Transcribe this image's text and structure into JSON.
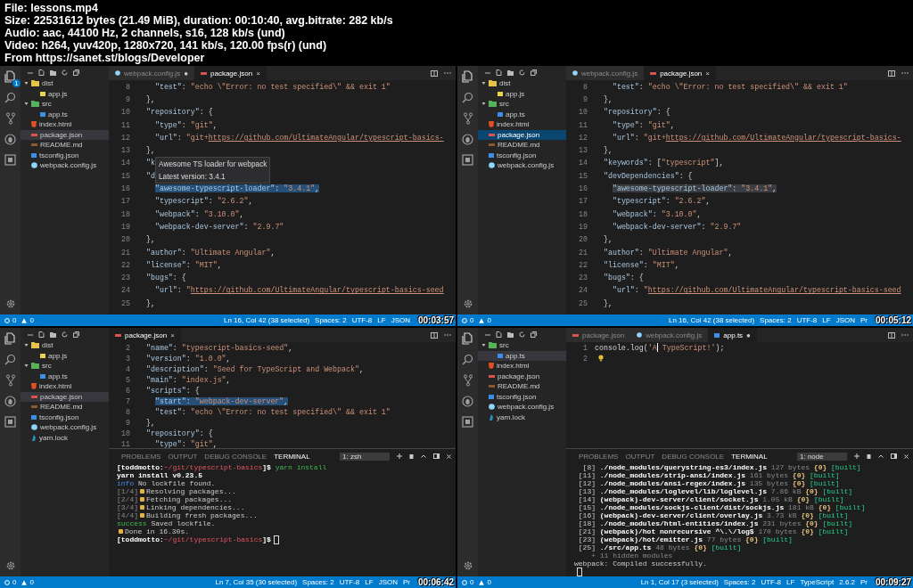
{
  "header": [
    "File: lessons.mp4",
    "Size: 22531612 bytes (21.49 MiB), duration: 00:10:40, avg.bitrate: 282 kb/s",
    "Audio: aac, 44100 Hz, 2 channels, s16, 128 kb/s (und)",
    "Video: h264, yuv420p, 1280x720, 141 kb/s, 120.00 fps(r) (und)",
    "From https://sanet.st/blogs/Developer"
  ],
  "panes": [
    {
      "activity_badge": "1",
      "explorer_focused": false,
      "editor_focused": true,
      "explorer": [
        {
          "name": "dist",
          "kind": "folder",
          "color": "#e8c34a",
          "expanded": true,
          "selected": false,
          "children": [
            {
              "name": "app.js",
              "kind": "js",
              "selected": false
            }
          ]
        },
        {
          "name": "src",
          "kind": "folder",
          "color": "#56b35a",
          "expanded": true,
          "selected": false,
          "children": [
            {
              "name": "app.ts",
              "kind": "ts",
              "selected": false
            }
          ]
        },
        {
          "name": "index.html",
          "kind": "html",
          "selected": false
        },
        {
          "name": "package.json",
          "kind": "json",
          "selected": true
        },
        {
          "name": "README.md",
          "kind": "md",
          "selected": false
        },
        {
          "name": "tsconfig.json",
          "kind": "tsconfig",
          "selected": false
        },
        {
          "name": "webpack.config.js",
          "kind": "webpack",
          "selected": false
        }
      ],
      "tabs": [
        {
          "label": "webpack.config.js",
          "kind": "webpack",
          "selected": false,
          "marker": "●"
        },
        {
          "label": "package.json",
          "kind": "json",
          "selected": true,
          "marker": "×"
        }
      ],
      "lines": [
        {
          "num": "8",
          "tokens": [
            {
              "kind": "key",
              "text": "    \"test\""
            },
            {
              "kind": "punct",
              "text": ": "
            },
            {
              "kind": "str",
              "text": "\"echo \\\"Error: no test specified\\\" && exit 1\""
            }
          ]
        },
        {
          "num": "9",
          "tokens": [
            {
              "kind": "punct",
              "text": "  },"
            }
          ]
        },
        {
          "num": "10",
          "tokens": [
            {
              "kind": "key",
              "text": "  \"repository\""
            },
            {
              "kind": "punct",
              "text": ": {"
            }
          ]
        },
        {
          "num": "11",
          "tokens": [
            {
              "kind": "key",
              "text": "    \"type\""
            },
            {
              "kind": "punct",
              "text": ": "
            },
            {
              "kind": "str",
              "text": "\"git\""
            },
            {
              "kind": "punct",
              "text": ","
            }
          ]
        },
        {
          "num": "12",
          "tokens": [
            {
              "kind": "key",
              "text": "    \"url\""
            },
            {
              "kind": "punct",
              "text": ": "
            },
            {
              "kind": "str",
              "text": "\"git+"
            },
            {
              "kind": "link",
              "text": "https://github.com/UltimateAngular/typescript-basics-"
            }
          ]
        },
        {
          "num": "13",
          "tokens": [
            {
              "kind": "punct",
              "text": "  },"
            }
          ]
        },
        {
          "num": "14",
          "tokens": [
            {
              "kind": "key",
              "text": "  \"k"
            }
          ],
          "tooltip": [
            "Awesome TS loader for webpack",
            "Latest version: 3.4.1"
          ]
        },
        {
          "num": "15",
          "tokens": [
            {
              "kind": "key",
              "text": "  \"d"
            }
          ]
        },
        {
          "num": "16",
          "selected": true,
          "tokens": [
            {
              "kind": "key",
              "text": "    \"awesome-typescript-loader\""
            },
            {
              "kind": "punct",
              "text": ": "
            },
            {
              "kind": "str",
              "text": "\"3.4.1\""
            },
            {
              "kind": "punct",
              "text": ","
            }
          ]
        },
        {
          "num": "17",
          "tokens": [
            {
              "kind": "key",
              "text": "    \"typescript\""
            },
            {
              "kind": "punct",
              "text": ": "
            },
            {
              "kind": "str",
              "text": "\"2.6.2\""
            },
            {
              "kind": "punct",
              "text": ","
            }
          ]
        },
        {
          "num": "18",
          "tokens": [
            {
              "kind": "key",
              "text": "    \"webpack\""
            },
            {
              "kind": "punct",
              "text": ": "
            },
            {
              "kind": "str",
              "text": "\"3.10.0\""
            },
            {
              "kind": "punct",
              "text": ","
            }
          ]
        },
        {
          "num": "19",
          "tokens": [
            {
              "kind": "key",
              "text": "    \"webpack-dev-server\""
            },
            {
              "kind": "punct",
              "text": ": "
            },
            {
              "kind": "str",
              "text": "\"2.9.7\""
            }
          ]
        },
        {
          "num": "20",
          "tokens": [
            {
              "kind": "punct",
              "text": "  },"
            }
          ]
        },
        {
          "num": "21",
          "tokens": [
            {
              "kind": "key",
              "text": "  \"author\""
            },
            {
              "kind": "punct",
              "text": ": "
            },
            {
              "kind": "str",
              "text": "\"Ultimate Angular\""
            },
            {
              "kind": "punct",
              "text": ","
            }
          ]
        },
        {
          "num": "22",
          "tokens": [
            {
              "kind": "key",
              "text": "  \"license\""
            },
            {
              "kind": "punct",
              "text": ": "
            },
            {
              "kind": "str",
              "text": "\"MIT\""
            },
            {
              "kind": "punct",
              "text": ","
            }
          ]
        },
        {
          "num": "23",
          "tokens": [
            {
              "kind": "key",
              "text": "  \"bugs\""
            },
            {
              "kind": "punct",
              "text": ": {"
            }
          ]
        },
        {
          "num": "24",
          "tokens": [
            {
              "kind": "key",
              "text": "    \"url\""
            },
            {
              "kind": "punct",
              "text": ": "
            },
            {
              "kind": "str",
              "text": "\""
            },
            {
              "kind": "link",
              "text": "https://github.com/UltimateAngular/typescript-basics-seed"
            }
          ]
        },
        {
          "num": "25",
          "tokens": [
            {
              "kind": "punct",
              "text": "  },"
            }
          ]
        }
      ],
      "status": {
        "errors": "0",
        "warnings": "0",
        "items": [
          "Ln 16, Col 42 (38 selected)",
          "Spaces: 2",
          "UTF-8",
          "LF",
          "JSON"
        ],
        "timestamp": "00:03:57"
      }
    },
    {
      "explorer_focused": true,
      "editor_focused": false,
      "explorer": [
        {
          "name": "dist",
          "kind": "folder",
          "color": "#e8c34a",
          "expanded": true,
          "selected": false,
          "children": [
            {
              "name": "app.js",
              "kind": "js",
              "selected": false
            }
          ]
        },
        {
          "name": "src",
          "kind": "folder",
          "color": "#56b35a",
          "expanded": true,
          "selected": false,
          "children": [
            {
              "name": "app.ts",
              "kind": "ts",
              "selected": false
            }
          ]
        },
        {
          "name": "index.html",
          "kind": "html",
          "selected": false
        },
        {
          "name": "package.json",
          "kind": "json",
          "selected": true
        },
        {
          "name": "README.md",
          "kind": "md",
          "selected": false
        },
        {
          "name": "tsconfig.json",
          "kind": "tsconfig",
          "selected": false
        },
        {
          "name": "webpack.config.js",
          "kind": "webpack",
          "selected": false
        }
      ],
      "tabs": [
        {
          "label": "webpack.config.js",
          "kind": "webpack",
          "selected": false
        },
        {
          "label": "package.json",
          "kind": "json",
          "selected": true,
          "marker": "×"
        }
      ],
      "lines": [
        {
          "num": "8",
          "tokens": [
            {
              "kind": "key",
              "text": "    \"test\""
            },
            {
              "kind": "punct",
              "text": ": "
            },
            {
              "kind": "str",
              "text": "\"echo \\\"Error: no test specified\\\" && exit 1\""
            }
          ]
        },
        {
          "num": "9",
          "tokens": [
            {
              "kind": "punct",
              "text": "  },"
            }
          ]
        },
        {
          "num": "10",
          "tokens": [
            {
              "kind": "key",
              "text": "  \"repository\""
            },
            {
              "kind": "punct",
              "text": ": {"
            }
          ]
        },
        {
          "num": "11",
          "tokens": [
            {
              "kind": "key",
              "text": "    \"type\""
            },
            {
              "kind": "punct",
              "text": ": "
            },
            {
              "kind": "str",
              "text": "\"git\""
            },
            {
              "kind": "punct",
              "text": ","
            }
          ]
        },
        {
          "num": "12",
          "tokens": [
            {
              "kind": "key",
              "text": "    \"url\""
            },
            {
              "kind": "punct",
              "text": ": "
            },
            {
              "kind": "str",
              "text": "\"git+"
            },
            {
              "kind": "link",
              "text": "https://github.com/UltimateAngular/typescript-basics-"
            }
          ]
        },
        {
          "num": "13",
          "tokens": [
            {
              "kind": "punct",
              "text": "  },"
            }
          ]
        },
        {
          "num": "14",
          "tokens": [
            {
              "kind": "key",
              "text": "  \"keywords\""
            },
            {
              "kind": "punct",
              "text": ": ["
            },
            {
              "kind": "str",
              "text": "\"typescript\""
            },
            {
              "kind": "punct",
              "text": "],"
            }
          ]
        },
        {
          "num": "15",
          "tokens": [
            {
              "kind": "key",
              "text": "  \"devDependencies\""
            },
            {
              "kind": "punct",
              "text": ": {"
            }
          ]
        },
        {
          "num": "16",
          "selected": true,
          "tokens": [
            {
              "kind": "key",
              "text": "    \"awesome-typescript-loader\""
            },
            {
              "kind": "punct",
              "text": ": "
            },
            {
              "kind": "str",
              "text": "\"3.4.1\""
            },
            {
              "kind": "punct",
              "text": ","
            }
          ]
        },
        {
          "num": "17",
          "tokens": [
            {
              "kind": "key",
              "text": "    \"typescript\""
            },
            {
              "kind": "punct",
              "text": ": "
            },
            {
              "kind": "str",
              "text": "\"2.6.2\""
            },
            {
              "kind": "punct",
              "text": ","
            }
          ]
        },
        {
          "num": "18",
          "tokens": [
            {
              "kind": "key",
              "text": "    \"webpack\""
            },
            {
              "kind": "punct",
              "text": ": "
            },
            {
              "kind": "str",
              "text": "\"3.10.0\""
            },
            {
              "kind": "punct",
              "text": ","
            }
          ]
        },
        {
          "num": "19",
          "tokens": [
            {
              "kind": "key",
              "text": "    \"webpack-dev-server\""
            },
            {
              "kind": "punct",
              "text": ": "
            },
            {
              "kind": "str",
              "text": "\"2.9.7\""
            }
          ]
        },
        {
          "num": "20",
          "tokens": [
            {
              "kind": "punct",
              "text": "  },"
            }
          ]
        },
        {
          "num": "21",
          "tokens": [
            {
              "kind": "key",
              "text": "  \"author\""
            },
            {
              "kind": "punct",
              "text": ": "
            },
            {
              "kind": "str",
              "text": "\"Ultimate Angular\""
            },
            {
              "kind": "punct",
              "text": ","
            }
          ]
        },
        {
          "num": "22",
          "tokens": [
            {
              "kind": "key",
              "text": "  \"license\""
            },
            {
              "kind": "punct",
              "text": ": "
            },
            {
              "kind": "str",
              "text": "\"MIT\""
            },
            {
              "kind": "punct",
              "text": ","
            }
          ]
        },
        {
          "num": "23",
          "tokens": [
            {
              "kind": "key",
              "text": "  \"bugs\""
            },
            {
              "kind": "punct",
              "text": ": {"
            }
          ]
        },
        {
          "num": "24",
          "tokens": [
            {
              "kind": "key",
              "text": "    \"url\""
            },
            {
              "kind": "punct",
              "text": ": "
            },
            {
              "kind": "str",
              "text": "\""
            },
            {
              "kind": "link",
              "text": "https://github.com/UltimateAngular/typescript-basics-seed"
            }
          ]
        },
        {
          "num": "25",
          "tokens": [
            {
              "kind": "punct",
              "text": "  },"
            }
          ]
        }
      ],
      "status": {
        "errors": "0",
        "warnings": "0",
        "items": [
          "Ln 16, Col 42 (38 selected)",
          "Spaces: 2",
          "UTF-8",
          "LF",
          "JSON",
          "Pr"
        ],
        "timestamp": "00:05:12"
      }
    },
    {
      "explorer_focused": false,
      "editor_focused": true,
      "explorer": [
        {
          "name": "dist",
          "kind": "folder",
          "color": "#e8c34a",
          "expanded": true,
          "selected": false,
          "children": [
            {
              "name": "app.js",
              "kind": "js",
              "selected": false
            }
          ]
        },
        {
          "name": "src",
          "kind": "folder",
          "color": "#56b35a",
          "expanded": true,
          "selected": false,
          "children": [
            {
              "name": "app.ts",
              "kind": "ts",
              "selected": false
            }
          ]
        },
        {
          "name": "index.html",
          "kind": "html",
          "selected": false
        },
        {
          "name": "package.json",
          "kind": "json",
          "selected": true
        },
        {
          "name": "README.md",
          "kind": "md",
          "selected": false
        },
        {
          "name": "tsconfig.json",
          "kind": "tsconfig",
          "selected": false
        },
        {
          "name": "webpack.config.js",
          "kind": "webpack",
          "selected": false
        },
        {
          "name": "yarn.lock",
          "kind": "yarn",
          "selected": false
        }
      ],
      "tabs": [
        {
          "label": "package.json",
          "kind": "json",
          "selected": true,
          "marker": "×"
        }
      ],
      "lines": [
        {
          "num": "2",
          "tokens": [
            {
              "kind": "key",
              "text": "  \"name\""
            },
            {
              "kind": "punct",
              "text": ": "
            },
            {
              "kind": "str",
              "text": "\"typescript-basics-seed\""
            },
            {
              "kind": "punct",
              "text": ","
            }
          ]
        },
        {
          "num": "3",
          "tokens": [
            {
              "kind": "key",
              "text": "  \"version\""
            },
            {
              "kind": "punct",
              "text": ": "
            },
            {
              "kind": "str",
              "text": "\"1.0.0\""
            },
            {
              "kind": "punct",
              "text": ","
            }
          ]
        },
        {
          "num": "4",
          "tokens": [
            {
              "kind": "key",
              "text": "  \"description\""
            },
            {
              "kind": "punct",
              "text": ": "
            },
            {
              "kind": "str",
              "text": "\"Seed for TypeScript and Webpack\""
            },
            {
              "kind": "punct",
              "text": ","
            }
          ]
        },
        {
          "num": "5",
          "tokens": [
            {
              "kind": "key",
              "text": "  \"main\""
            },
            {
              "kind": "punct",
              "text": ": "
            },
            {
              "kind": "str",
              "text": "\"index.js\""
            },
            {
              "kind": "punct",
              "text": ","
            }
          ]
        },
        {
          "num": "6",
          "tokens": [
            {
              "kind": "key",
              "text": "  \"scripts\""
            },
            {
              "kind": "punct",
              "text": ": {"
            }
          ]
        },
        {
          "num": "7",
          "selected": true,
          "tokens": [
            {
              "kind": "key",
              "text": "    \"start\""
            },
            {
              "kind": "punct",
              "text": ": "
            },
            {
              "kind": "str",
              "text": "\"webpack-dev-server\""
            },
            {
              "kind": "punct",
              "text": ","
            }
          ]
        },
        {
          "num": "8",
          "tokens": [
            {
              "kind": "key",
              "text": "    \"test\""
            },
            {
              "kind": "punct",
              "text": ": "
            },
            {
              "kind": "str",
              "text": "\"echo \\\"Error: no test specified\\\" && exit 1\""
            }
          ]
        },
        {
          "num": "9",
          "tokens": [
            {
              "kind": "punct",
              "text": "  },"
            }
          ]
        },
        {
          "num": "10",
          "tokens": [
            {
              "kind": "key",
              "text": "  \"repository\""
            },
            {
              "kind": "punct",
              "text": ": {"
            }
          ]
        },
        {
          "num": "11",
          "tokens": [
            {
              "kind": "key",
              "text": "    \"type\""
            },
            {
              "kind": "punct",
              "text": ": "
            },
            {
              "kind": "str",
              "text": "\"git\""
            },
            {
              "kind": "punct",
              "text": ","
            }
          ]
        }
      ],
      "terminal": {
        "tabs": [
          {
            "label": "PROBLEMS",
            "selected": false
          },
          {
            "label": "OUTPUT",
            "selected": false
          },
          {
            "label": "DEBUG CONSOLE",
            "selected": false
          },
          {
            "label": "TERMINAL",
            "selected": true
          }
        ],
        "shell": "1: zsh",
        "lines": [
          [
            {
              "kind": "bold",
              "text": "[toddmotto:"
            },
            {
              "kind": "path",
              "text": "~/git/typescript-basics"
            },
            {
              "kind": "bold",
              "text": "]$ "
            },
            {
              "kind": "cmd",
              "text": "yarn install"
            }
          ],
          [
            {
              "kind": "bold",
              "text": "yarn install v0.23.5"
            }
          ],
          [
            {
              "kind": "info",
              "text": "info"
            },
            {
              "kind": "plain",
              "text": " No lockfile found."
            }
          ],
          [
            {
              "kind": "dim",
              "text": "[1/4]"
            },
            {
              "kind": "emoji"
            },
            {
              "kind": "plain",
              "text": "Resolving packages..."
            }
          ],
          [
            {
              "kind": "dim",
              "text": "[2/4]"
            },
            {
              "kind": "emoji"
            },
            {
              "kind": "plain",
              "text": "Fetching packages..."
            }
          ],
          [
            {
              "kind": "dim",
              "text": "[3/4]"
            },
            {
              "kind": "emoji"
            },
            {
              "kind": "plain",
              "text": "Linking dependencies..."
            }
          ],
          [
            {
              "kind": "dim",
              "text": "[4/4]"
            },
            {
              "kind": "emoji"
            },
            {
              "kind": "plain",
              "text": "Building fresh packages..."
            }
          ],
          [
            {
              "kind": "success",
              "text": "success"
            },
            {
              "kind": "plain",
              "text": " Saved lockfile."
            }
          ],
          [
            {
              "kind": "emoji"
            },
            {
              "kind": "plain",
              "text": "Done in 16.30s."
            }
          ],
          [
            {
              "kind": "bold",
              "text": "[toddmotto:"
            },
            {
              "kind": "path",
              "text": "~/git/typescript-basics"
            },
            {
              "kind": "bold",
              "text": "]$"
            },
            {
              "kind": "cursor"
            }
          ]
        ]
      },
      "status": {
        "errors": "0",
        "warnings": "0",
        "items": [
          "Ln 7, Col 35 (30 selected)",
          "Spaces: 2",
          "UTF-8",
          "LF",
          "JSON",
          "Pr"
        ],
        "timestamp": "00:06:42"
      }
    },
    {
      "explorer_focused": false,
      "explorer": [
        {
          "name": "src",
          "kind": "folder",
          "color": "#56b35a",
          "expanded": true,
          "selected": false,
          "children": [
            {
              "name": "app.ts",
              "kind": "ts",
              "selected": true
            }
          ]
        },
        {
          "name": "index.html",
          "kind": "html",
          "selected": false
        },
        {
          "name": "package.json",
          "kind": "json",
          "selected": false
        },
        {
          "name": "README.md",
          "kind": "md",
          "selected": false
        },
        {
          "name": "tsconfig.json",
          "kind": "tsconfig",
          "selected": false
        },
        {
          "name": "webpack.config.js",
          "kind": "webpack",
          "selected": false
        },
        {
          "name": "yarn.lock",
          "kind": "yarn",
          "selected": false
        }
      ],
      "tabs": [
        {
          "label": "package.json",
          "kind": "json",
          "selected": false
        },
        {
          "label": "webpack.config.js",
          "kind": "webpack",
          "selected": false
        },
        {
          "label": "app.ts",
          "kind": "ts",
          "selected": true,
          "marker": "●"
        }
      ],
      "lines": [
        {
          "num": "1",
          "tokens": [
            {
              "kind": "plain",
              "text": "console.log("
            },
            {
              "kind": "str",
              "text": "'A"
            },
            {
              "kind": "caret"
            },
            {
              "kind": "str",
              "text": " TypeScript!'"
            },
            {
              "kind": "plain",
              "text": ");"
            }
          ]
        },
        {
          "num": "2",
          "tokens": [
            {
              "kind": "bulb"
            }
          ]
        }
      ],
      "terminal": {
        "tabs": [
          {
            "label": "PROBLEMS",
            "selected": false
          },
          {
            "label": "OUTPUT",
            "selected": false
          },
          {
            "label": "DEBUG CONSOLE",
            "selected": false
          },
          {
            "label": "TERMINAL",
            "selected": true
          }
        ],
        "shell": "1: node",
        "lines": [
          [
            {
              "kind": "plain",
              "text": "  [8] "
            },
            {
              "kind": "bold",
              "text": "./node_modules/querystring-es3/index.js"
            },
            {
              "kind": "dim",
              "text": " 127 bytes "
            },
            {
              "kind": "chunk",
              "text": "{0}"
            },
            {
              "kind": "built",
              "text": " [built]"
            }
          ],
          [
            {
              "kind": "plain",
              "text": " [11] "
            },
            {
              "kind": "bold",
              "text": "./node_modules/strip-ansi/index.js"
            },
            {
              "kind": "dim",
              "text": " 161 bytes "
            },
            {
              "kind": "chunk",
              "text": "{0}"
            },
            {
              "kind": "built",
              "text": " [built]"
            }
          ],
          [
            {
              "kind": "plain",
              "text": " [12] "
            },
            {
              "kind": "bold",
              "text": "./node_modules/ansi-regex/index.js"
            },
            {
              "kind": "dim",
              "text": " 135 bytes "
            },
            {
              "kind": "chunk",
              "text": "{0}"
            },
            {
              "kind": "built",
              "text": " [built]"
            }
          ],
          [
            {
              "kind": "plain",
              "text": " [13] "
            },
            {
              "kind": "bold",
              "text": "./node_modules/loglevel/lib/loglevel.js"
            },
            {
              "kind": "dim",
              "text": " 7.86 kB "
            },
            {
              "kind": "chunk",
              "text": "{0}"
            },
            {
              "kind": "built",
              "text": " [built]"
            }
          ],
          [
            {
              "kind": "plain",
              "text": " [14] "
            },
            {
              "kind": "bold",
              "text": "(webpack)-dev-server/client/socket.js"
            },
            {
              "kind": "dim",
              "text": " 1.05 kB "
            },
            {
              "kind": "chunk",
              "text": "{0}"
            },
            {
              "kind": "built",
              "text": " [built]"
            }
          ],
          [
            {
              "kind": "plain",
              "text": " [15] "
            },
            {
              "kind": "bold",
              "text": "./node_modules/sockjs-client/dist/sockjs.js"
            },
            {
              "kind": "dim",
              "text": " 181 kB "
            },
            {
              "kind": "chunk",
              "text": "{0}"
            },
            {
              "kind": "built",
              "text": " [built]"
            }
          ],
          [
            {
              "kind": "plain",
              "text": " [16] "
            },
            {
              "kind": "bold",
              "text": "(webpack)-dev-server/client/overlay.js"
            },
            {
              "kind": "dim",
              "text": " 3.73 kB "
            },
            {
              "kind": "chunk",
              "text": "{0}"
            },
            {
              "kind": "built",
              "text": " [built]"
            }
          ],
          [
            {
              "kind": "plain",
              "text": " [18] "
            },
            {
              "kind": "bold",
              "text": "./node_modules/html-entities/index.js"
            },
            {
              "kind": "dim",
              "text": " 231 bytes "
            },
            {
              "kind": "chunk",
              "text": "{0}"
            },
            {
              "kind": "built",
              "text": " [built]"
            }
          ],
          [
            {
              "kind": "plain",
              "text": " [21] "
            },
            {
              "kind": "bold",
              "text": "(webpack)/hot nonrecursive ^\\.\\/log$"
            },
            {
              "kind": "dim",
              "text": " 170 bytes "
            },
            {
              "kind": "chunk",
              "text": "{0}"
            },
            {
              "kind": "built",
              "text": " [built]"
            }
          ],
          [
            {
              "kind": "plain",
              "text": " [23] "
            },
            {
              "kind": "bold",
              "text": "(webpack)/hot/emitter.js"
            },
            {
              "kind": "dim",
              "text": " 77 bytes "
            },
            {
              "kind": "chunk",
              "text": "{0}"
            },
            {
              "kind": "built",
              "text": " [built]"
            }
          ],
          [
            {
              "kind": "plain",
              "text": " [25] "
            },
            {
              "kind": "bold",
              "text": "./src/app.ts"
            },
            {
              "kind": "dim",
              "text": " 48 bytes "
            },
            {
              "kind": "chunk",
              "text": "{0}"
            },
            {
              "kind": "built",
              "text": " [built]"
            }
          ],
          [
            {
              "kind": "dim",
              "text": "    + 11 hidden modules"
            }
          ],
          [
            {
              "kind": "plain",
              "text": "webpack: Compiled successfully."
            }
          ],
          [
            {
              "kind": "cursor"
            }
          ]
        ]
      },
      "status": {
        "errors": "0",
        "warnings": "0",
        "items": [
          "Ln 1, Col 17 (3 selected)",
          "Spaces: 2",
          "UTF-8",
          "LF",
          "TypeScript",
          "2.6.2",
          "Pr"
        ],
        "timestamp": "00:09:27"
      }
    }
  ]
}
